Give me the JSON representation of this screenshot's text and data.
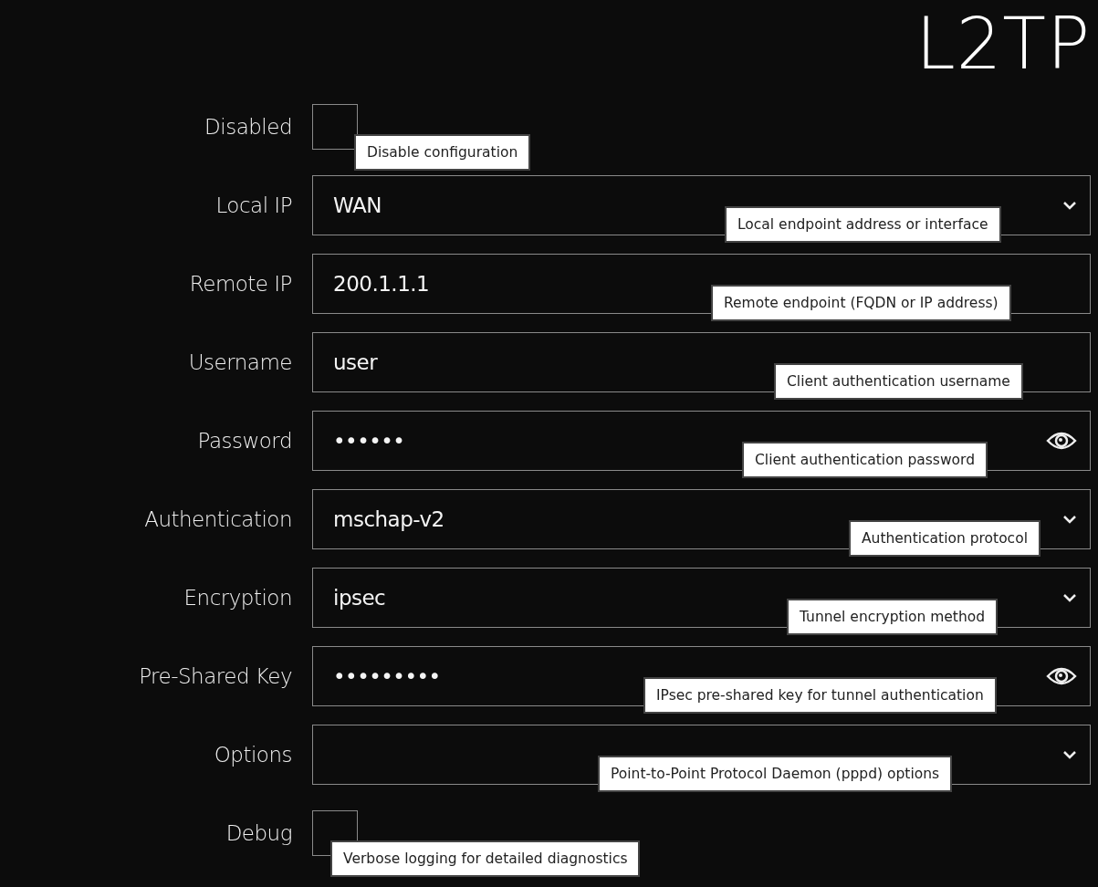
{
  "title": "L2TP",
  "fields": [
    {
      "kind": "checkbox",
      "label": "Disabled",
      "checked": false,
      "hint": "Disable configuration"
    },
    {
      "kind": "select",
      "label": "Local IP",
      "value": "WAN",
      "hint": "Local endpoint address or interface"
    },
    {
      "kind": "text",
      "label": "Remote IP",
      "value": "200.1.1.1",
      "hint": "Remote endpoint (FQDN or IP address)"
    },
    {
      "kind": "text",
      "label": "Username",
      "value": "user",
      "hint": "Client authentication username"
    },
    {
      "kind": "password",
      "label": "Password",
      "value": "••••••",
      "hint": "Client authentication password"
    },
    {
      "kind": "select",
      "label": "Authentication",
      "value": "mschap-v2",
      "hint": "Authentication protocol"
    },
    {
      "kind": "select",
      "label": "Encryption",
      "value": "ipsec",
      "hint": "Tunnel encryption method"
    },
    {
      "kind": "password",
      "label": "Pre-Shared Key",
      "value": "•••••••••",
      "hint": "IPsec pre-shared key for tunnel authentication"
    },
    {
      "kind": "select",
      "label": "Options",
      "hint": "Point-to-Point Protocol Daemon (pppd) options"
    },
    {
      "kind": "checkbox",
      "label": "Debug",
      "checked": false,
      "hint": "Verbose logging for detailed diagnostics"
    }
  ]
}
